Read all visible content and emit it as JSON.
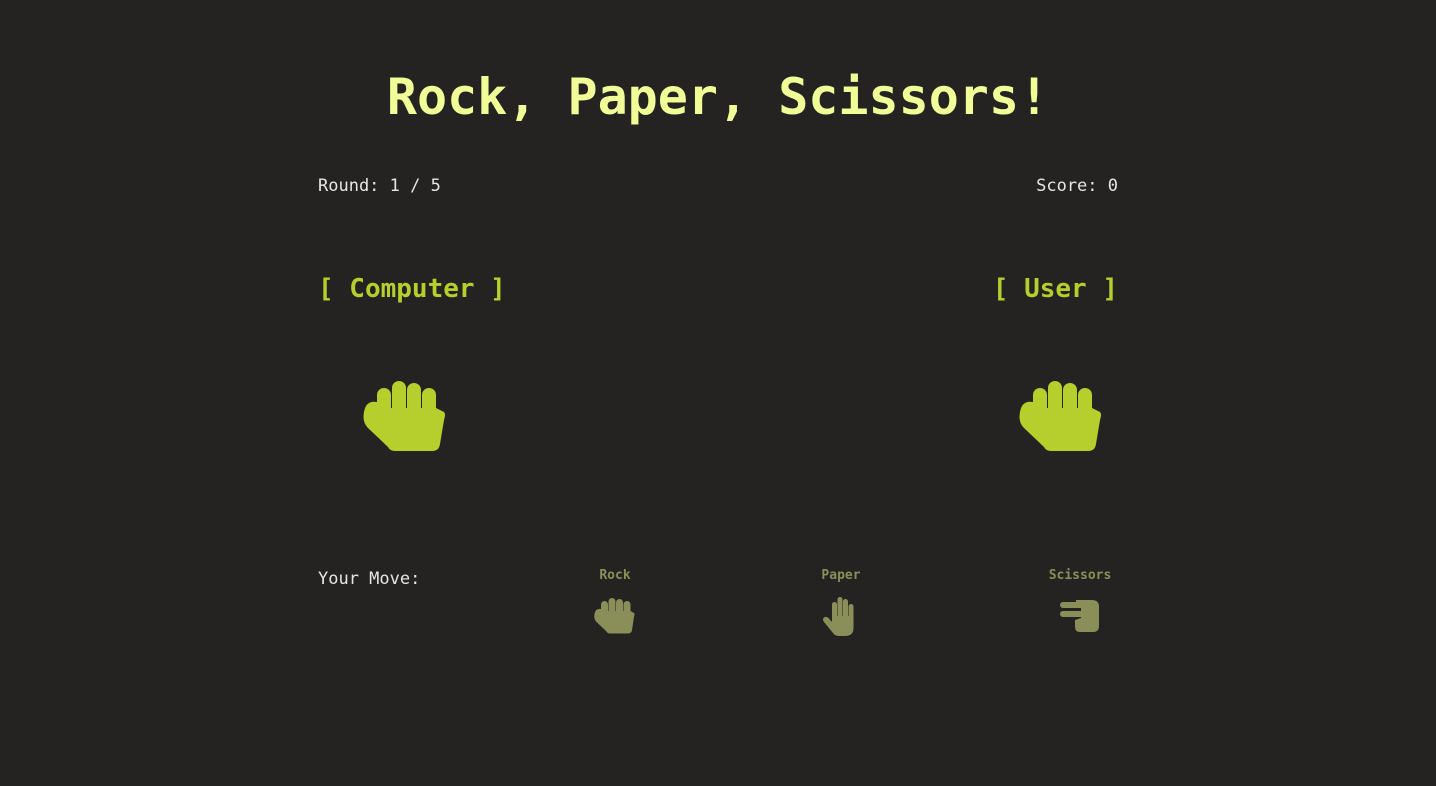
{
  "header": {
    "title": "Rock, Paper, Scissors!"
  },
  "status": {
    "round": "Round: 1 / 5",
    "score": "Score: 0"
  },
  "players": {
    "computer_label": "[ Computer ]",
    "user_label": "[ User ]",
    "computer_move_icon": "fist-icon",
    "user_move_icon": "fist-icon"
  },
  "moves": {
    "prompt": "Your Move:",
    "options": [
      {
        "label": "Rock",
        "icon": "fist-icon"
      },
      {
        "label": "Paper",
        "icon": "open-hand-icon"
      },
      {
        "label": "Scissors",
        "icon": "peace-hand-icon"
      }
    ]
  },
  "colors": {
    "background": "#242322",
    "title": "#f1fd97",
    "accent": "#b7cf2d",
    "muted": "#8a8f59",
    "text": "#e6e6e6"
  }
}
